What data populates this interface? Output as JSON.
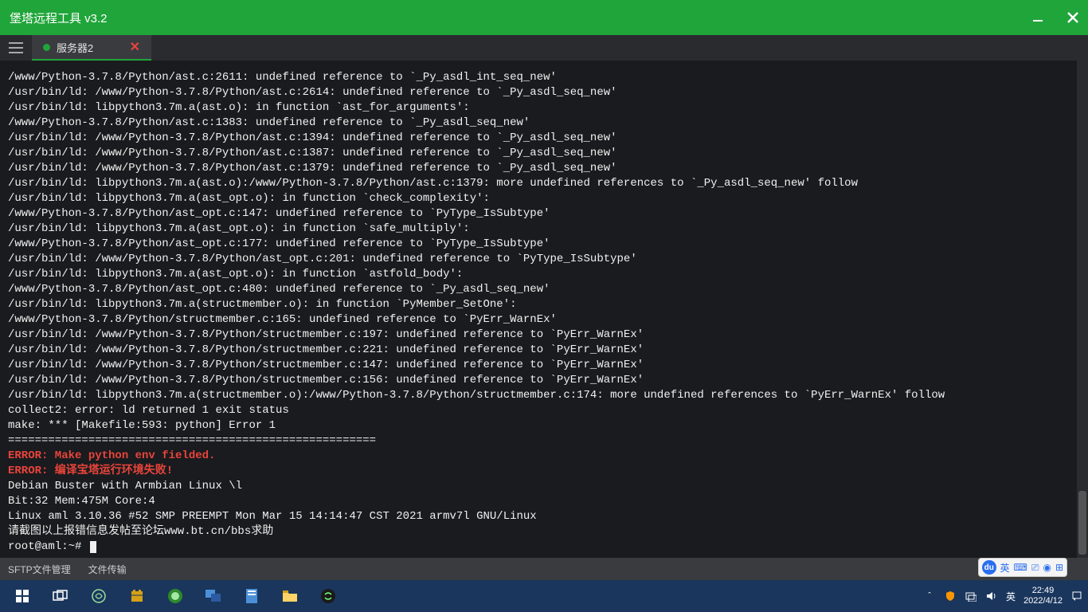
{
  "window": {
    "title": "堡塔远程工具 v3.2"
  },
  "tab": {
    "label": "服务器2"
  },
  "terminal": {
    "lines": [
      {
        "t": "/www/Python-3.7.8/Python/ast.c:2611: undefined reference to `_Py_asdl_int_seq_new'"
      },
      {
        "t": "/usr/bin/ld: /www/Python-3.7.8/Python/ast.c:2614: undefined reference to `_Py_asdl_seq_new'"
      },
      {
        "t": "/usr/bin/ld: libpython3.7m.a(ast.o): in function `ast_for_arguments':"
      },
      {
        "t": "/www/Python-3.7.8/Python/ast.c:1383: undefined reference to `_Py_asdl_seq_new'"
      },
      {
        "t": "/usr/bin/ld: /www/Python-3.7.8/Python/ast.c:1394: undefined reference to `_Py_asdl_seq_new'"
      },
      {
        "t": "/usr/bin/ld: /www/Python-3.7.8/Python/ast.c:1387: undefined reference to `_Py_asdl_seq_new'"
      },
      {
        "t": "/usr/bin/ld: /www/Python-3.7.8/Python/ast.c:1379: undefined reference to `_Py_asdl_seq_new'"
      },
      {
        "t": "/usr/bin/ld: libpython3.7m.a(ast.o):/www/Python-3.7.8/Python/ast.c:1379: more undefined references to `_Py_asdl_seq_new' follow"
      },
      {
        "t": "/usr/bin/ld: libpython3.7m.a(ast_opt.o): in function `check_complexity':"
      },
      {
        "t": "/www/Python-3.7.8/Python/ast_opt.c:147: undefined reference to `PyType_IsSubtype'"
      },
      {
        "t": "/usr/bin/ld: libpython3.7m.a(ast_opt.o): in function `safe_multiply':"
      },
      {
        "t": "/www/Python-3.7.8/Python/ast_opt.c:177: undefined reference to `PyType_IsSubtype'"
      },
      {
        "t": "/usr/bin/ld: /www/Python-3.7.8/Python/ast_opt.c:201: undefined reference to `PyType_IsSubtype'"
      },
      {
        "t": "/usr/bin/ld: libpython3.7m.a(ast_opt.o): in function `astfold_body':"
      },
      {
        "t": "/www/Python-3.7.8/Python/ast_opt.c:480: undefined reference to `_Py_asdl_seq_new'"
      },
      {
        "t": "/usr/bin/ld: libpython3.7m.a(structmember.o): in function `PyMember_SetOne':"
      },
      {
        "t": "/www/Python-3.7.8/Python/structmember.c:165: undefined reference to `PyErr_WarnEx'"
      },
      {
        "t": "/usr/bin/ld: /www/Python-3.7.8/Python/structmember.c:197: undefined reference to `PyErr_WarnEx'"
      },
      {
        "t": "/usr/bin/ld: /www/Python-3.7.8/Python/structmember.c:221: undefined reference to `PyErr_WarnEx'"
      },
      {
        "t": "/usr/bin/ld: /www/Python-3.7.8/Python/structmember.c:147: undefined reference to `PyErr_WarnEx'"
      },
      {
        "t": "/usr/bin/ld: /www/Python-3.7.8/Python/structmember.c:156: undefined reference to `PyErr_WarnEx'"
      },
      {
        "t": "/usr/bin/ld: libpython3.7m.a(structmember.o):/www/Python-3.7.8/Python/structmember.c:174: more undefined references to `PyErr_WarnEx' follow"
      },
      {
        "t": "collect2: error: ld returned 1 exit status"
      },
      {
        "t": "make: *** [Makefile:593: python] Error 1"
      },
      {
        "t": "======================================================="
      },
      {
        "t": "ERROR: Make python env fielded.",
        "err": true
      },
      {
        "t": "ERROR: 编译宝塔运行环境失败!",
        "err": true
      },
      {
        "t": "Debian Buster with Armbian Linux \\l"
      },
      {
        "t": "Bit:32 Mem:475M Core:4"
      },
      {
        "t": "Linux aml 3.10.36 #52 SMP PREEMPT Mon Mar 15 14:14:47 CST 2021 armv7l GNU/Linux"
      },
      {
        "t": "请截图以上报错信息发帖至论坛www.bt.cn/bbs求助"
      }
    ],
    "prompt": "root@aml:~# "
  },
  "bottombar": {
    "sftp": "SFTP文件管理",
    "transfer": "文件传输"
  },
  "float": {
    "ime": "英"
  },
  "tray": {
    "ime": "英",
    "time": "22:49",
    "date": "2022/4/12"
  }
}
